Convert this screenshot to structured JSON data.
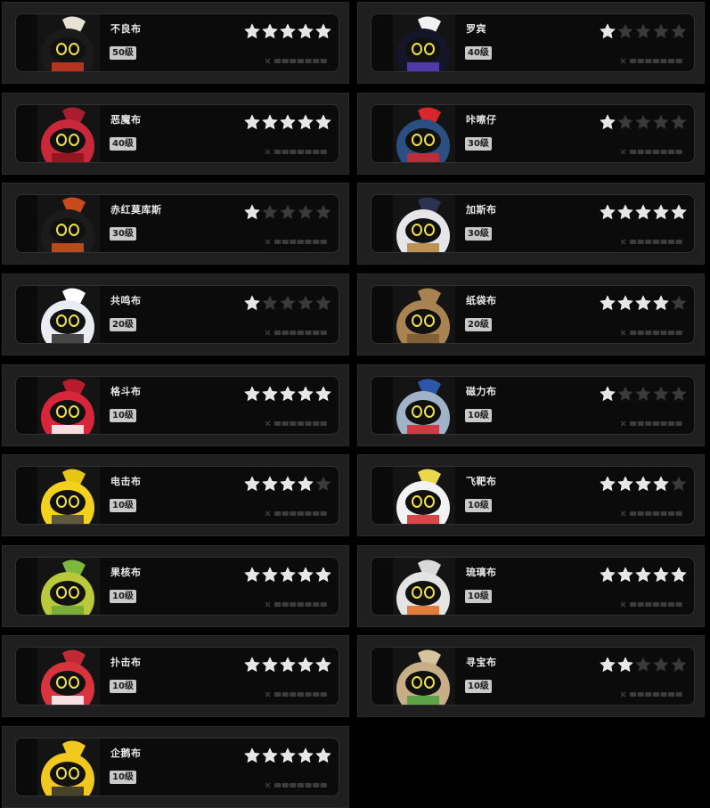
{
  "cards": [
    {
      "name": "不良布",
      "level": "50级",
      "stars": 5,
      "body_color": "#1a1a1a",
      "accent_color": "#d23b22",
      "hat_color": "#e8e2d4"
    },
    {
      "name": "罗宾",
      "level": "40级",
      "stars": 1,
      "body_color": "#14142a",
      "accent_color": "#5a3fc0",
      "hat_color": "#f2f2f2"
    },
    {
      "name": "恶魔布",
      "level": "40级",
      "stars": 5,
      "body_color": "#c8283a",
      "accent_color": "#8a1420",
      "hat_color": "#a81e2e"
    },
    {
      "name": "咔嚓仔",
      "level": "30级",
      "stars": 1,
      "body_color": "#2a4f80",
      "accent_color": "#d7262c",
      "hat_color": "#d7262c"
    },
    {
      "name": "赤红莫库斯",
      "level": "30级",
      "stars": 1,
      "body_color": "#1b1b1b",
      "accent_color": "#d2541e",
      "hat_color": "#c84a1a"
    },
    {
      "name": "加斯布",
      "level": "30级",
      "stars": 5,
      "body_color": "#e6e6ea",
      "accent_color": "#b6833c",
      "hat_color": "#2c3350"
    },
    {
      "name": "共鸣布",
      "level": "20级",
      "stars": 1,
      "body_color": "#e9ecf2",
      "accent_color": "#2a2a2a",
      "hat_color": "#ffffff"
    },
    {
      "name": "纸袋布",
      "level": "20级",
      "stars": 4,
      "body_color": "#a98252",
      "accent_color": "#7a5a34",
      "hat_color": "#a98252"
    },
    {
      "name": "格斗布",
      "level": "10级",
      "stars": 5,
      "body_color": "#d7263a",
      "accent_color": "#ffffff",
      "hat_color": "#b81c2c"
    },
    {
      "name": "磁力布",
      "level": "10级",
      "stars": 1,
      "body_color": "#9fb2c8",
      "accent_color": "#d7262c",
      "hat_color": "#2e56a8"
    },
    {
      "name": "电击布",
      "level": "10级",
      "stars": 4,
      "body_color": "#f2d21c",
      "accent_color": "#444444",
      "hat_color": "#e6c612"
    },
    {
      "name": "飞靶布",
      "level": "10级",
      "stars": 4,
      "body_color": "#f2f2f2",
      "accent_color": "#d42a2a",
      "hat_color": "#e8d84a"
    },
    {
      "name": "果核布",
      "level": "10级",
      "stars": 5,
      "body_color": "#b9c93a",
      "accent_color": "#6ea73a",
      "hat_color": "#7bb83c"
    },
    {
      "name": "琉璃布",
      "level": "10级",
      "stars": 5,
      "body_color": "#e4e4e4",
      "accent_color": "#e06a1c",
      "hat_color": "#d9d9d9"
    },
    {
      "name": "扑击布",
      "level": "10级",
      "stars": 5,
      "body_color": "#d9343e",
      "accent_color": "#ffffff",
      "hat_color": "#c02a34"
    },
    {
      "name": "寻宝布",
      "level": "10级",
      "stars": 2,
      "body_color": "#c8ae86",
      "accent_color": "#4aa03a",
      "hat_color": "#d6c4a0"
    },
    {
      "name": "企鹅布",
      "level": "10级",
      "stars": 5,
      "body_color": "#f0c81e",
      "accent_color": "#2a2a2a",
      "hat_color": "#f0c81e"
    }
  ],
  "max_stars": 5,
  "colors": {
    "star_on": "#e6e6e6",
    "star_off": "#3a3a3a",
    "sub_bar": "#3c3c3c"
  }
}
